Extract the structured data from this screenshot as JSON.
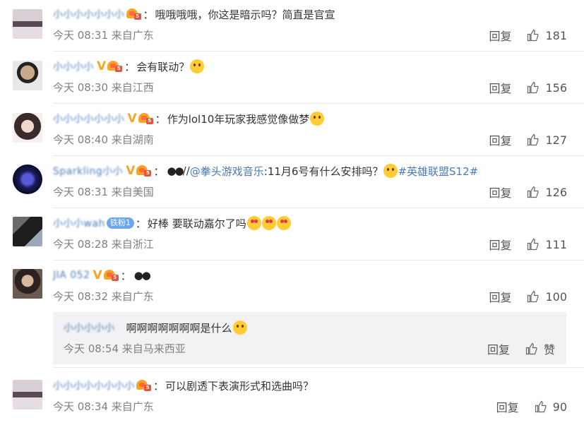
{
  "comments": [
    {
      "user": "小小小小小小小",
      "vip": false,
      "text": "哦哦哦哦，你这是暗示吗？简直是官宣",
      "time": "今天 08:31",
      "loc": "来自广东",
      "reply": "回复",
      "likes": "181"
    },
    {
      "user": "小小小小",
      "vip": true,
      "text": "会有联动？",
      "time": "今天 08:30",
      "loc": "来自江西",
      "reply": "回复",
      "likes": "156"
    },
    {
      "user": "小小小小小小小",
      "vip": true,
      "text": "作为lol10年玩家我感觉像做梦",
      "time": "今天 08:40",
      "loc": "来自湖南",
      "reply": "回复",
      "likes": "127"
    },
    {
      "user": "Sparkling小小",
      "vip": true,
      "text_pre": "//",
      "mention": "@拳头游戏音乐",
      "text_mid": ":11月6号有什么安排吗？",
      "hashtag": "#英雄联盟S12#",
      "time": "今天 08:31",
      "loc": "来自美国",
      "reply": "回复",
      "likes": "126"
    },
    {
      "user": "小小小wah",
      "badge": "铁粉1",
      "text": "好棒 要联动嘉尔了吗",
      "time": "今天 08:28",
      "loc": "来自浙江",
      "reply": "回复",
      "likes": "111"
    },
    {
      "user": "JIA 052",
      "vip": true,
      "text": "",
      "time": "今天 08:32",
      "loc": "来自广东",
      "reply": "回复",
      "likes": "100"
    },
    {
      "user": "小小小小小小小小",
      "vip": false,
      "text": "可以剧透下表演形式和选曲吗？",
      "time": "今天 08:34",
      "loc": "来自广东",
      "reply": "回复",
      "likes": "90"
    }
  ],
  "sub_reply": {
    "user": "小小小小小",
    "text": "啊啊啊啊啊啊啊是什么",
    "time": "今天 08:54",
    "loc": "来自马来西亚",
    "reply": "回复",
    "like_label": "赞"
  },
  "colors": {
    "link": "#4a7ab8",
    "vip": "#f5a623",
    "badge": "#6ea6ea",
    "meta": "#808080",
    "sub_bg": "#f2f2f5"
  }
}
